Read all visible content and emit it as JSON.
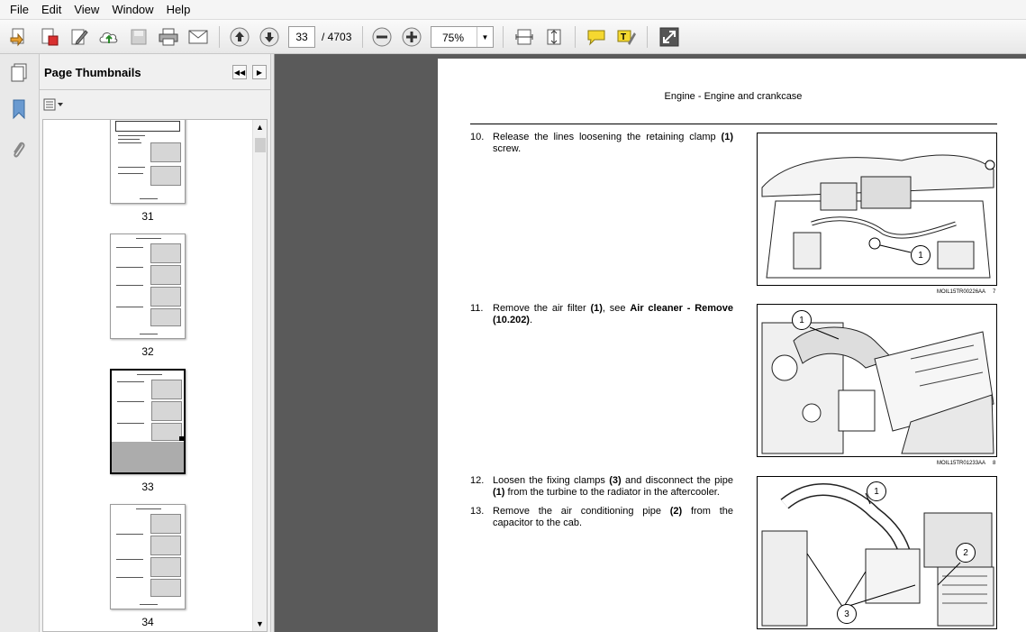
{
  "menu": [
    "File",
    "Edit",
    "View",
    "Window",
    "Help"
  ],
  "toolbar": {
    "current_page": "33",
    "total_pages": "/ 4703",
    "zoom": "75%"
  },
  "panel": {
    "title": "Page Thumbnails"
  },
  "thumbnails": [
    {
      "page": "31"
    },
    {
      "page": "32"
    },
    {
      "page": "33",
      "selected": true
    },
    {
      "page": "34"
    }
  ],
  "document": {
    "header": "Engine - Engine and crankcase",
    "steps": [
      {
        "no": "10.",
        "text_a": "Release the lines loosening the retaining clamp ",
        "bold_a": "(1)",
        "text_b": " screw."
      },
      {
        "no": "11.",
        "text_a": "Remove the air filter ",
        "bold_a": "(1)",
        "text_b": ", see ",
        "bold_b": "Air cleaner - Remove (10.202)",
        "text_c": "."
      },
      {
        "no": "12.",
        "text_a": "Loosen the fixing clamps ",
        "bold_a": "(3)",
        "text_b": " and disconnect the pipe ",
        "bold_b": "(1)",
        "text_c": " from the turbine to the radiator in the aftercooler."
      },
      {
        "no": "13.",
        "text_a": "Remove the air conditioning pipe ",
        "bold_a": "(2)",
        "text_b": " from the capacitor to the cab."
      }
    ],
    "figures": [
      {
        "caption": "MOIL15TR00226AA",
        "number": "7",
        "callouts": [
          "1"
        ]
      },
      {
        "caption": "MOIL15TR01233AA",
        "number": "8",
        "callouts": [
          "1"
        ]
      },
      {
        "callouts": [
          "1",
          "2",
          "3"
        ]
      }
    ]
  }
}
